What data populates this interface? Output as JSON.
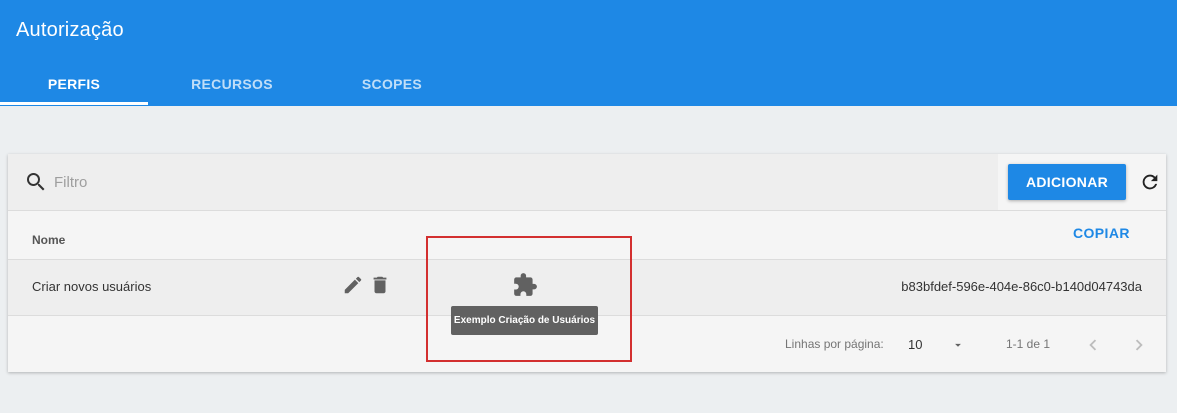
{
  "app": {
    "title": "Autorização"
  },
  "tabs": [
    {
      "label": "PERFIS",
      "active": true
    },
    {
      "label": "RECURSOS",
      "active": false
    },
    {
      "label": "SCOPES",
      "active": false
    }
  ],
  "toolbar": {
    "search_placeholder": "Filtro",
    "search_value": "",
    "add_label": "ADICIONAR"
  },
  "table": {
    "columns": [
      "Nome"
    ],
    "copy_label": "COPIAR",
    "rows": [
      {
        "name": "Criar novos usuários",
        "id": "b83bfdef-596e-404e-86c0-b140d04743da"
      }
    ]
  },
  "tooltip": {
    "text": "Exemplo Criação de Usuários"
  },
  "pagination": {
    "rows_per_page_label": "Linhas por página:",
    "rows_per_page_value": "10",
    "range_label": "1-1 de 1"
  },
  "icons": {
    "search": "search-icon",
    "refresh": "refresh-icon",
    "edit": "pencil-icon",
    "delete": "trash-icon",
    "puzzle": "puzzle-icon",
    "dropdown": "caret-down-icon",
    "prev": "chevron-left-icon",
    "next": "chevron-right-icon"
  },
  "colors": {
    "primary": "#1e88e5",
    "background": "#eceff1",
    "highlight": "#d32f2f",
    "tooltip": "#616161"
  }
}
